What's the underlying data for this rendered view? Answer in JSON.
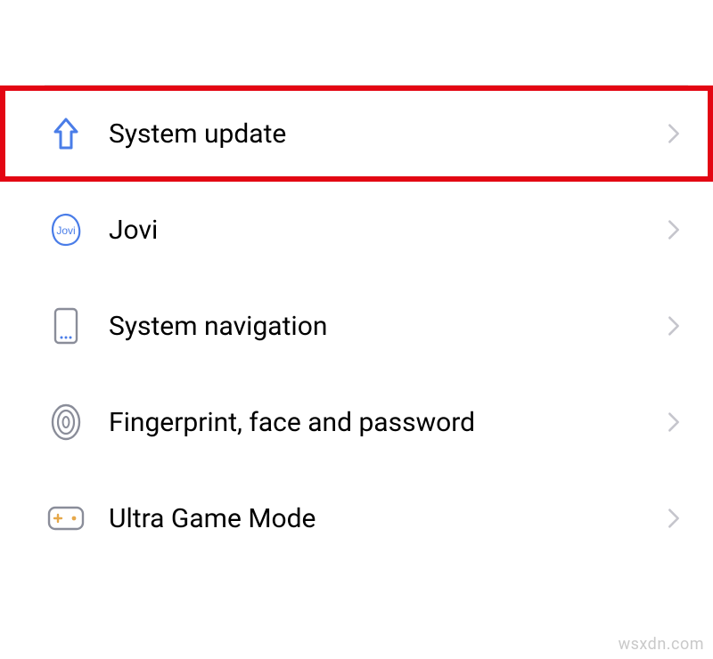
{
  "settings": {
    "items": [
      {
        "id": "system-update",
        "label": "System update",
        "icon": "arrow-up",
        "highlighted": true
      },
      {
        "id": "jovi",
        "label": "Jovi",
        "icon": "jovi",
        "highlighted": false
      },
      {
        "id": "system-navigation",
        "label": "System navigation",
        "icon": "phone-nav",
        "highlighted": false
      },
      {
        "id": "fingerprint-face-password",
        "label": "Fingerprint, face and password",
        "icon": "fingerprint",
        "highlighted": false
      },
      {
        "id": "ultra-game-mode",
        "label": "Ultra Game Mode",
        "icon": "gamepad",
        "highlighted": false
      }
    ]
  },
  "watermark": "wsxdn.com",
  "colors": {
    "highlight_border": "#e30613",
    "icon_blue": "#4a7de8",
    "icon_gray": "#8a8d99",
    "chevron": "#c5c5cc"
  }
}
